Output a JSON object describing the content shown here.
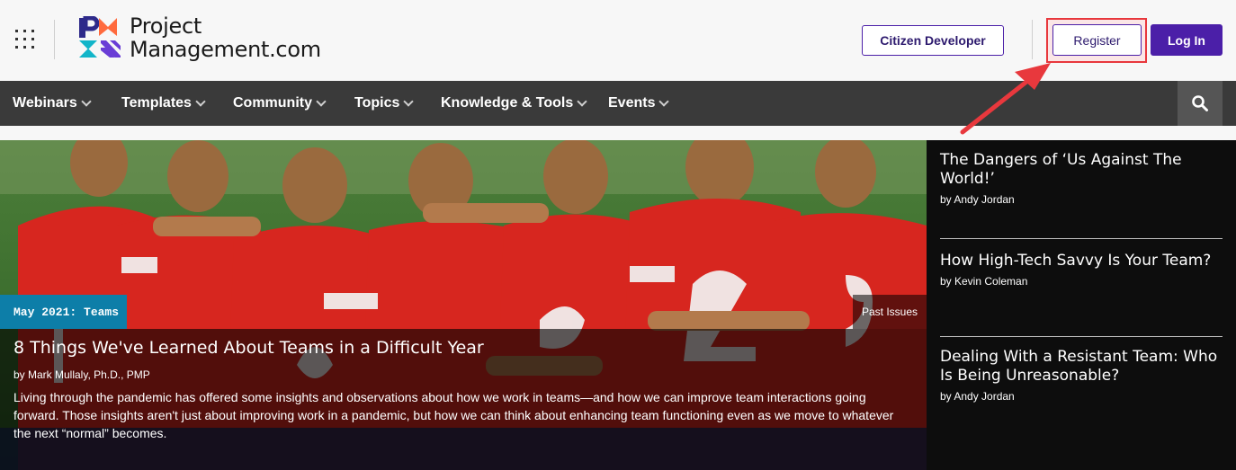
{
  "header": {
    "logo_line1": "Project",
    "logo_line2": "Management.com",
    "citizen_label": "Citizen Developer",
    "register_label": "Register",
    "login_label": "Log In"
  },
  "nav": {
    "items": [
      "Webinars",
      "Templates",
      "Community",
      "Topics",
      "Knowledge & Tools",
      "Events"
    ]
  },
  "hero": {
    "issue_tag": "May 2021: Teams",
    "past_issues": "Past Issues",
    "title": "8 Things We've Learned About Teams in a Difficult Year",
    "byline": "by Mark Mullaly, Ph.D., PMP",
    "description": "Living through the pandemic has offered some insights and observations about how we work in teams—and how we can improve team interactions going forward. Those insights aren't just about improving work in a pandemic, but how we can think about enhancing team functioning even as we move to whatever the next “normal” becomes."
  },
  "sidebar": {
    "articles": [
      {
        "title": "The Dangers of ‘Us Against The World!’",
        "author": "by Andy Jordan"
      },
      {
        "title": "How High-Tech Savvy Is Your Team?",
        "author": "by Kevin Coleman"
      },
      {
        "title": "Dealing With a Resistant Team: Who Is Being Unreasonable?",
        "author": "by Andy Jordan"
      }
    ]
  },
  "colors": {
    "brand_purple": "#4b1fa8",
    "nav_bg": "#3a3a3a",
    "issue_blue": "#0d7ea8",
    "annotation_red": "#e8383d"
  },
  "icons": {
    "apps": "apps-grid-icon",
    "search": "search-icon",
    "chevron": "chevron-down-icon"
  }
}
